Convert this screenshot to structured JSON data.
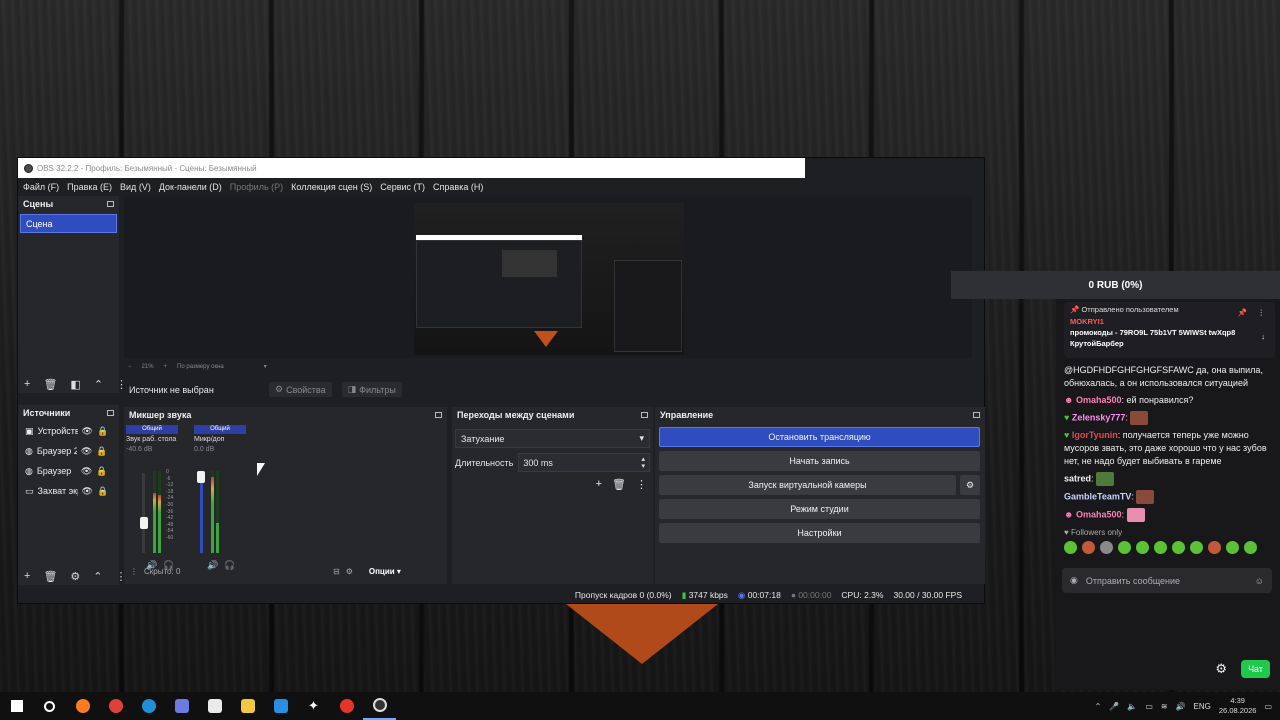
{
  "window": {
    "title": "OBS 32.2.2 - Профиль: Безымянный - Сцены: Безымянный"
  },
  "menu": [
    "Файл (F)",
    "Правка (E)",
    "Вид (V)",
    "Док-панели (D)",
    "Профиль (P)",
    "Коллекция сцен (S)",
    "Сервис (T)",
    "Справка (H)"
  ],
  "scenes": {
    "title": "Сцены",
    "items": [
      "Сцена"
    ]
  },
  "preview": {
    "zoom_value": "21%",
    "fit_label": "По размеру окна"
  },
  "source_bar": {
    "no_source": "Источник не выбран",
    "properties": "Свойства",
    "filters": "Фильтры"
  },
  "sources": {
    "title": "Источники",
    "items": [
      "Устройство",
      "Браузер 2",
      "Браузер",
      "Захват экрана"
    ]
  },
  "mixer": {
    "title": "Микшер звука",
    "channels": [
      {
        "tag": "Общий",
        "name": "Звук раб. стола",
        "db": "-40.6 dB",
        "level": 0.38
      },
      {
        "tag": "Общий",
        "name": "Микр/доп",
        "db": "0.0 dB",
        "level": 0.95
      }
    ],
    "scale": [
      "0",
      "-6",
      "-12",
      "-18",
      "-24",
      "-30",
      "-36",
      "-42",
      "-48",
      "-54",
      "-60"
    ],
    "hidden": "Скрыто: 0",
    "options": "Опции"
  },
  "transitions": {
    "title": "Переходы между сценами",
    "selected": "Затухание",
    "duration_label": "Длительность",
    "duration_value": "300 ms"
  },
  "controls": {
    "title": "Управление",
    "stop_stream": "Остановить трансляцию",
    "start_record": "Начать запись",
    "virtual_cam": "Запуск виртуальной камеры",
    "studio_mode": "Режим студии",
    "settings": "Настройки"
  },
  "status": {
    "dropped": "Пропуск кадров 0 (0.0%)",
    "bitrate": "3747 kbps",
    "stream_time": "00:07:18",
    "rec_time": "00:00:00",
    "cpu": "CPU: 2.3%",
    "fps": "30.00 / 30.00 FPS"
  },
  "chat": {
    "donation": "0 RUB (0%)",
    "pinned_header": "Отправлено пользователем",
    "pinned_user": "MOKRYI1",
    "pinned_msg": "промокоды - 79RO9L 75b1VT 5WIWSt twXqp8 КрутойБарбер",
    "messages": [
      {
        "user": "",
        "text": "@HGDFHDFGHFGHGFSFAWC да, она выпила, обнюхалась, а он использовался ситуацией",
        "color": "#efeff1"
      },
      {
        "user": "Omaha500",
        "text": "ей понравился?",
        "color": "#ff7eb6"
      },
      {
        "user": "Zelensky777",
        "text": "",
        "color": "#ff8cf0"
      },
      {
        "user": "IgorTyunin",
        "text": "получается теперь уже можно мусоров звать, это даже хорошо что у нас зубов нет, не надо будет выбивать в гареме",
        "color": "#e5484d"
      },
      {
        "user": "satred",
        "text": "",
        "color": "#efeff1"
      },
      {
        "user": "GambleTeamTV",
        "text": "",
        "color": "#c9d1ff"
      },
      {
        "user": "Omaha500",
        "text": "",
        "color": "#ff7eb6"
      }
    ],
    "followers_only": "Followers only",
    "input_placeholder": "Отправить сообщение",
    "chat_button": "Чат"
  },
  "taskbar": {
    "lang": "ENG",
    "time": "4:39",
    "date": "26.08.2026"
  }
}
